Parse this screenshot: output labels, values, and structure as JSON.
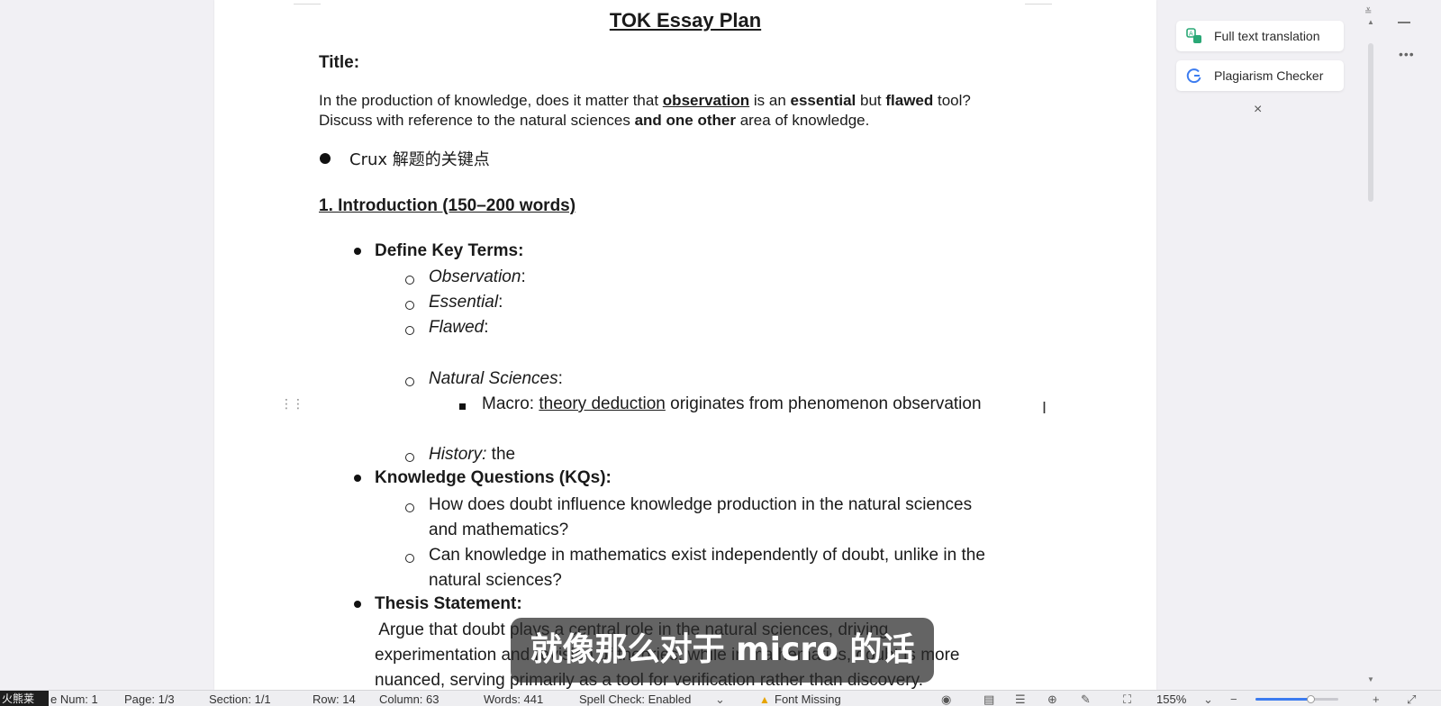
{
  "document": {
    "title": "TOK Essay Plan",
    "title_label": "Title:",
    "prompt": {
      "l1_a": "In the production of knowledge, does it matter that ",
      "l1_observation": "observation",
      "l1_b": " is an ",
      "l1_essential": "essential",
      "l1_c": " but ",
      "l1_flawed": "flawed",
      "l1_d": " tool?",
      "l2_a": "Discuss with reference to the natural sciences ",
      "l2_bold": "and one other",
      "l2_b": " area of knowledge."
    },
    "crux": "Crux 解题的关键点",
    "section1_heading": "1. Introduction (150–200 words)",
    "define_key_terms": "Define Key Terms:",
    "terms": {
      "observation": "Observation",
      "essential": "Essential",
      "flawed": "Flawed",
      "natural_sciences": "Natural Sciences",
      "history": "History:",
      "history_rest": " the",
      "colon": ":"
    },
    "macro": {
      "prefix": "Macro: ",
      "link": "theory deduction",
      "rest": " originates from phenomenon observation"
    },
    "kq_heading": "Knowledge Questions (KQs):",
    "kq1_line1": "How does doubt influence knowledge production in the natural sciences",
    "kq1_line2": "and mathematics?",
    "kq2_line1": "Can knowledge in mathematics exist independently of doubt, unlike in the",
    "kq2_line2": "natural sciences?",
    "thesis_heading": "Thesis Statement:",
    "thesis_line1": " Argue that doubt plays a central role in the natural sciences, driving",
    "thesis_line2": "experimentation and revision of theories, while in mathematics, doubt is more",
    "thesis_line3": "nuanced, serving primarily as a tool for verification rather than discovery."
  },
  "side_panel": {
    "full_text_translation": "Full text translation",
    "plagiarism_checker": "Plagiarism Checker",
    "close": "×",
    "more": "•••",
    "icons": [
      "translate-icon",
      "plagiarism-icon"
    ]
  },
  "subtitle": "就像那么对于 micro 的话",
  "status_bar": {
    "left_chip": "火熊莱",
    "page_num": "e Num: 1",
    "page": "Page: 1/3",
    "section": "Section: 1/1",
    "row": "Row: 14",
    "column": "Column: 63",
    "words": "Words: 441",
    "spell_check": "Spell Check: Enabled",
    "font_missing": "Font Missing",
    "zoom": "155%",
    "zoom_level_fraction": 0.66,
    "accent": "#3c7cf0"
  }
}
